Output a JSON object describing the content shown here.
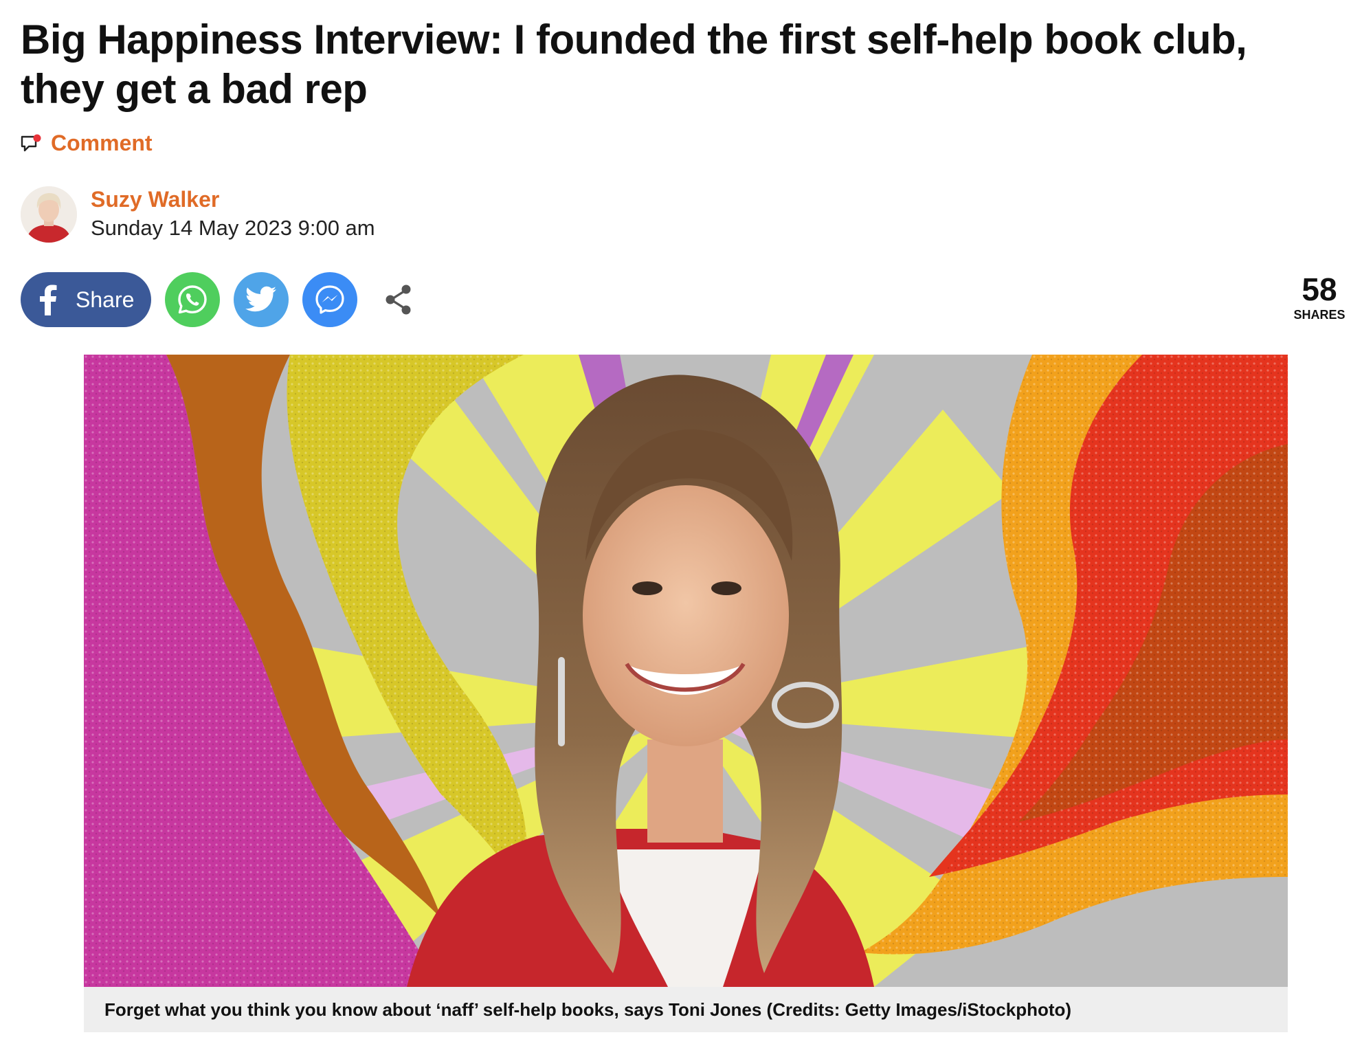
{
  "article": {
    "headline": "Big Happiness Interview: I founded the first self-help book club, they get a bad rep",
    "comment_label": "Comment",
    "author_name": "Suzy Walker",
    "published": "Sunday 14 May 2023 9:00 am"
  },
  "share_bar": {
    "facebook_label": "Share",
    "share_count": "58",
    "share_count_label": "SHARES",
    "buttons": [
      {
        "icon": "facebook-icon",
        "color": "#3b5998"
      },
      {
        "icon": "whatsapp-icon",
        "color": "#4fce5d"
      },
      {
        "icon": "twitter-icon",
        "color": "#4fa4e8"
      },
      {
        "icon": "messenger-icon",
        "color": "#3b8cf5"
      },
      {
        "icon": "share-icon",
        "color": "#555555"
      }
    ]
  },
  "hero_image": {
    "caption": "Forget what you think you know about ‘naff’ self-help books, says Toni Jones (Credits: Getty Images/iStockphoto)"
  },
  "colors": {
    "accent": "#e06b27",
    "headline": "#111111",
    "caption_bg": "#eeeeee"
  }
}
